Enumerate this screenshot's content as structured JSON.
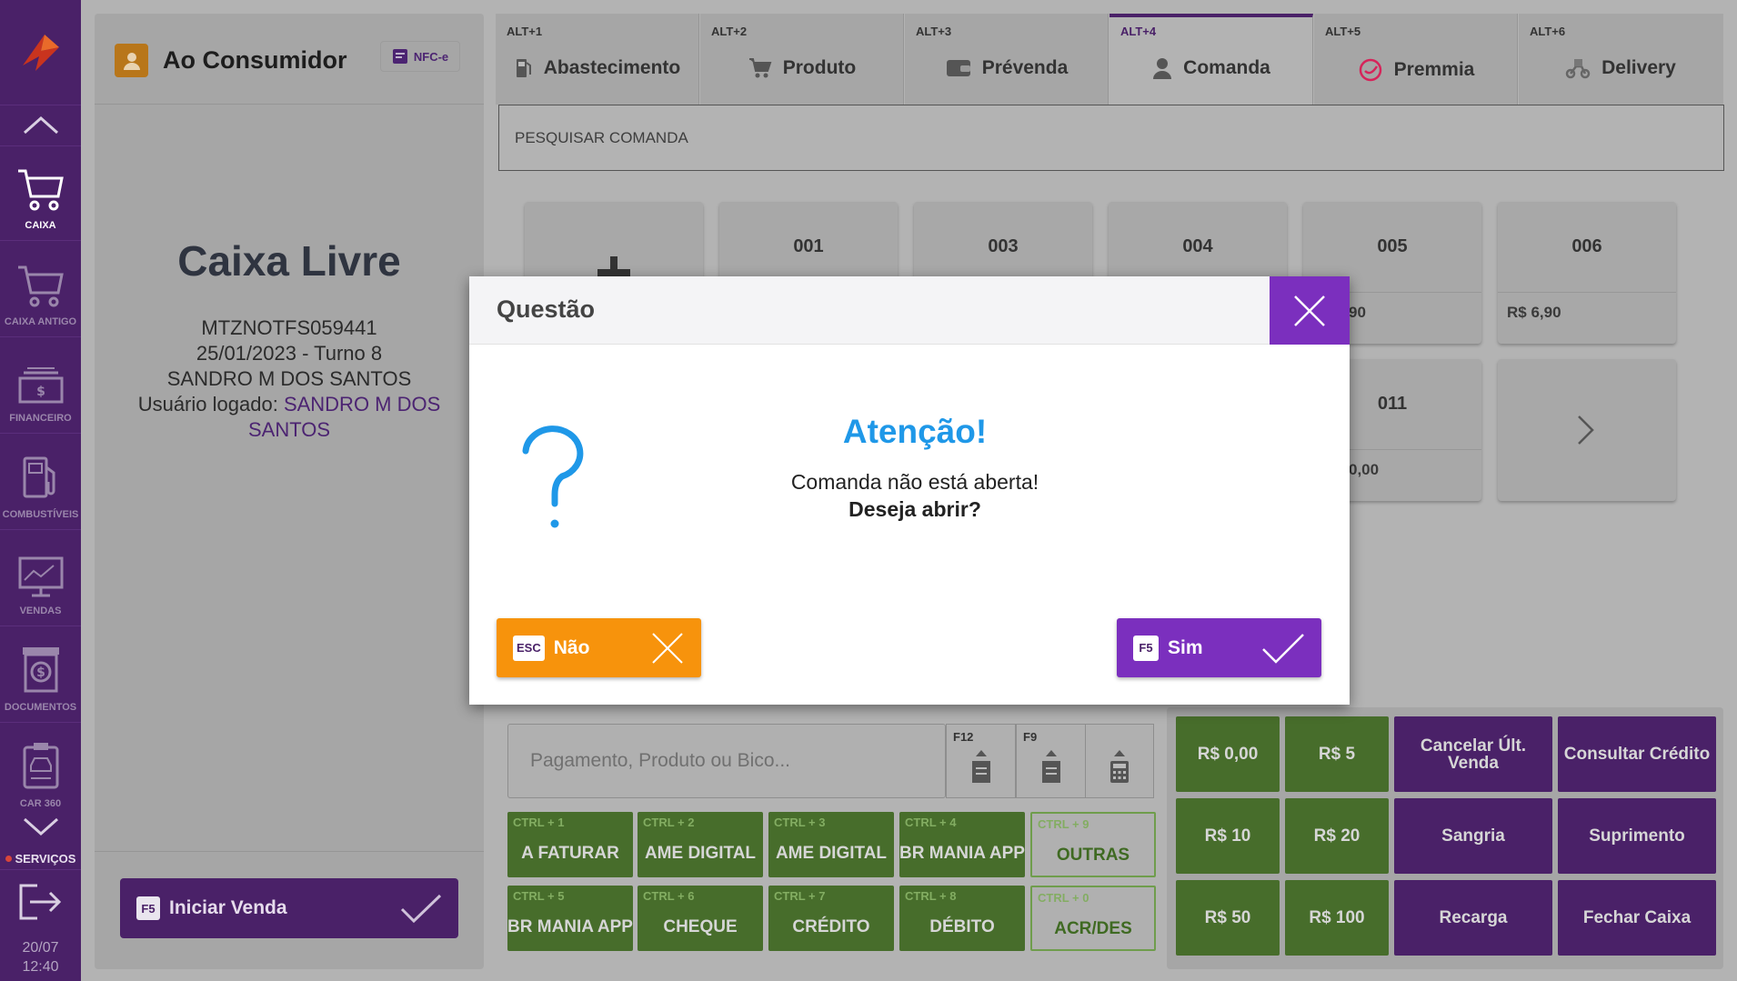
{
  "colors": {
    "purple_dark": "#4a2168",
    "purple_modal": "#7b2fbe",
    "orange": "#f7930c",
    "green": "#476d2b",
    "info_blue": "#1f98e8"
  },
  "sidebar": {
    "items": [
      {
        "label": "CAIXA",
        "icon": "cart-icon",
        "active": true
      },
      {
        "label": "CAIXA ANTIGO",
        "icon": "cart-icon"
      },
      {
        "label": "FINANCEIRO",
        "icon": "money-icon"
      },
      {
        "label": "COMBUSTÍVEIS",
        "icon": "fuel-pump-icon"
      },
      {
        "label": "VENDAS",
        "icon": "chart-monitor-icon"
      },
      {
        "label": "DOCUMENTOS",
        "icon": "document-dollar-icon"
      },
      {
        "label": "CAR 360",
        "icon": "car-clipboard-icon"
      }
    ],
    "servicos_label": "SERVIÇOS",
    "date": "20/07",
    "time": "12:40"
  },
  "left_panel": {
    "consumer_label": "Ao Consumidor",
    "nfce_label": "NFC-e",
    "status": "Caixa Livre",
    "terminal": "MTZNOTFS059441",
    "date_turn": "25/01/2023 - Turno 8",
    "operator": "SANDRO M DOS SANTOS",
    "logged_user_label": "Usuário logado:",
    "logged_user_name": "SANDRO M DOS SANTOS",
    "start_sale_key": "F5",
    "start_sale_label": "Iniciar Venda"
  },
  "tabs": [
    {
      "key": "ALT+1",
      "label": "Abastecimento",
      "icon": "fuel-pump-icon"
    },
    {
      "key": "ALT+2",
      "label": "Produto",
      "icon": "cart-icon"
    },
    {
      "key": "ALT+3",
      "label": "Prévenda",
      "icon": "wallet-icon"
    },
    {
      "key": "ALT+4",
      "label": "Comanda",
      "icon": "user-icon",
      "active": true
    },
    {
      "key": "ALT+5",
      "label": "Premmia",
      "icon": "premmia-icon"
    },
    {
      "key": "ALT+6",
      "label": "Delivery",
      "icon": "delivery-icon"
    }
  ],
  "search": {
    "placeholder": "PESQUISAR COMANDA"
  },
  "comandas": [
    {
      "number": "001",
      "value": ""
    },
    {
      "number": "003",
      "value": ""
    },
    {
      "number": "004",
      "value": ""
    },
    {
      "number": "005",
      "value": "90"
    },
    {
      "number": "006",
      "value": "R$ 6,90"
    },
    {
      "number": "011",
      "value": "0,00"
    }
  ],
  "payment": {
    "placeholder": "Pagamento, Produto ou Bico...",
    "buttons": [
      {
        "key": "F12",
        "icon": "receipt-up-icon"
      },
      {
        "key": "F9",
        "icon": "receipt-up-icon"
      },
      {
        "key": "",
        "icon": "calculator-icon"
      }
    ],
    "methods": [
      {
        "key": "CTRL + 1",
        "label": "A FATURAR"
      },
      {
        "key": "CTRL + 2",
        "label": "AME DIGITAL"
      },
      {
        "key": "CTRL + 3",
        "label": "AME DIGITAL"
      },
      {
        "key": "CTRL + 4",
        "label": "BR MANIA APP"
      },
      {
        "key": "CTRL + 9",
        "label": "OUTRAS"
      },
      {
        "key": "CTRL + 5",
        "label": "BR MANIA APP"
      },
      {
        "key": "CTRL + 6",
        "label": "CHEQUE"
      },
      {
        "key": "CTRL + 7",
        "label": "CRÉDITO"
      },
      {
        "key": "CTRL + 8",
        "label": "DÉBITO"
      },
      {
        "key": "CTRL + 0",
        "label": "ACR/DES"
      }
    ]
  },
  "quick": {
    "amounts": [
      "R$ 0,00",
      "R$ 5",
      "R$ 10",
      "R$ 20",
      "R$ 50",
      "R$ 100"
    ],
    "actions": [
      "Cancelar Últ. Venda",
      "Consultar Crédito",
      "Sangria",
      "Suprimento",
      "Recarga",
      "Fechar Caixa"
    ]
  },
  "modal": {
    "title": "Questão",
    "heading": "Atenção!",
    "message": "Comanda não está aberta!",
    "question": "Deseja abrir?",
    "no_key": "ESC",
    "no_label": "Não",
    "yes_key": "F5",
    "yes_label": "Sim"
  }
}
